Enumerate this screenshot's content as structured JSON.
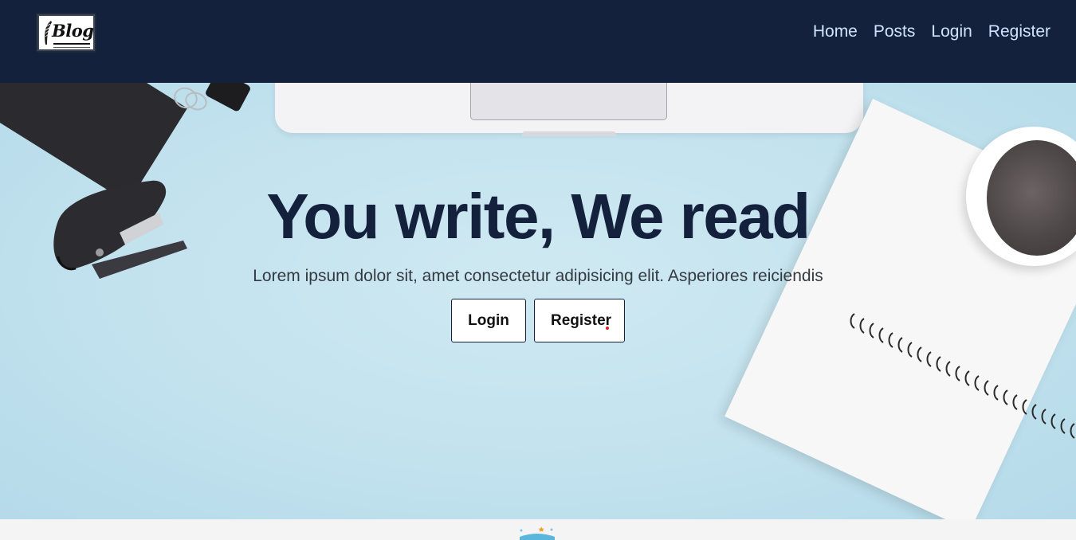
{
  "header": {
    "logo_text": "Blog",
    "nav": [
      {
        "label": "Home"
      },
      {
        "label": "Posts"
      },
      {
        "label": "Login"
      },
      {
        "label": "Register"
      }
    ]
  },
  "hero": {
    "title": "You write, We read",
    "subtitle": "Lorem ipsum dolor sit, amet consectetur adipisicing elit. Asperiores reiciendis",
    "buttons": {
      "login": "Login",
      "register": "Register"
    }
  },
  "colors": {
    "navbar_bg": "#14213d",
    "nav_link": "#cfe3ff",
    "hero_bg": "#c2e2ee",
    "title": "#14213d"
  },
  "icons": {
    "logo": "blog-feather-logo",
    "footer": "open-book-icon"
  }
}
